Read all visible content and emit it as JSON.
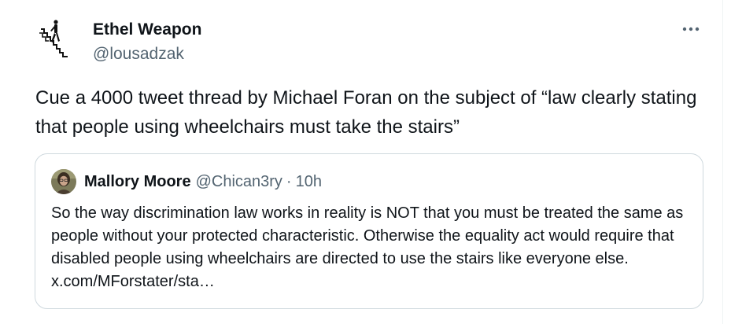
{
  "tweet": {
    "author_name": "Ethel Weapon",
    "author_handle": "@lousadzak",
    "avatar_icon": "stairs-wheelchair-figure-icon",
    "more_icon": "more-horizontal-icon",
    "text": "Cue a 4000 tweet thread by Michael Foran on the subject of “law clearly stating that people using wheelchairs must take the stairs”"
  },
  "quote": {
    "author_name": "Mallory Moore",
    "author_handle": "@Chican3ry",
    "separator": "·",
    "time": "10h",
    "text": "So the way discrimination law works in reality is NOT that you must be treated the same as people without your protected characteristic. Otherwise the equality act would require that disabled people using wheelchairs are directed to use the stairs like everyone else. x.com/MForstater/sta…"
  },
  "colors": {
    "text_primary": "#0f1419",
    "text_secondary": "#536471",
    "border": "#cfd9de"
  }
}
